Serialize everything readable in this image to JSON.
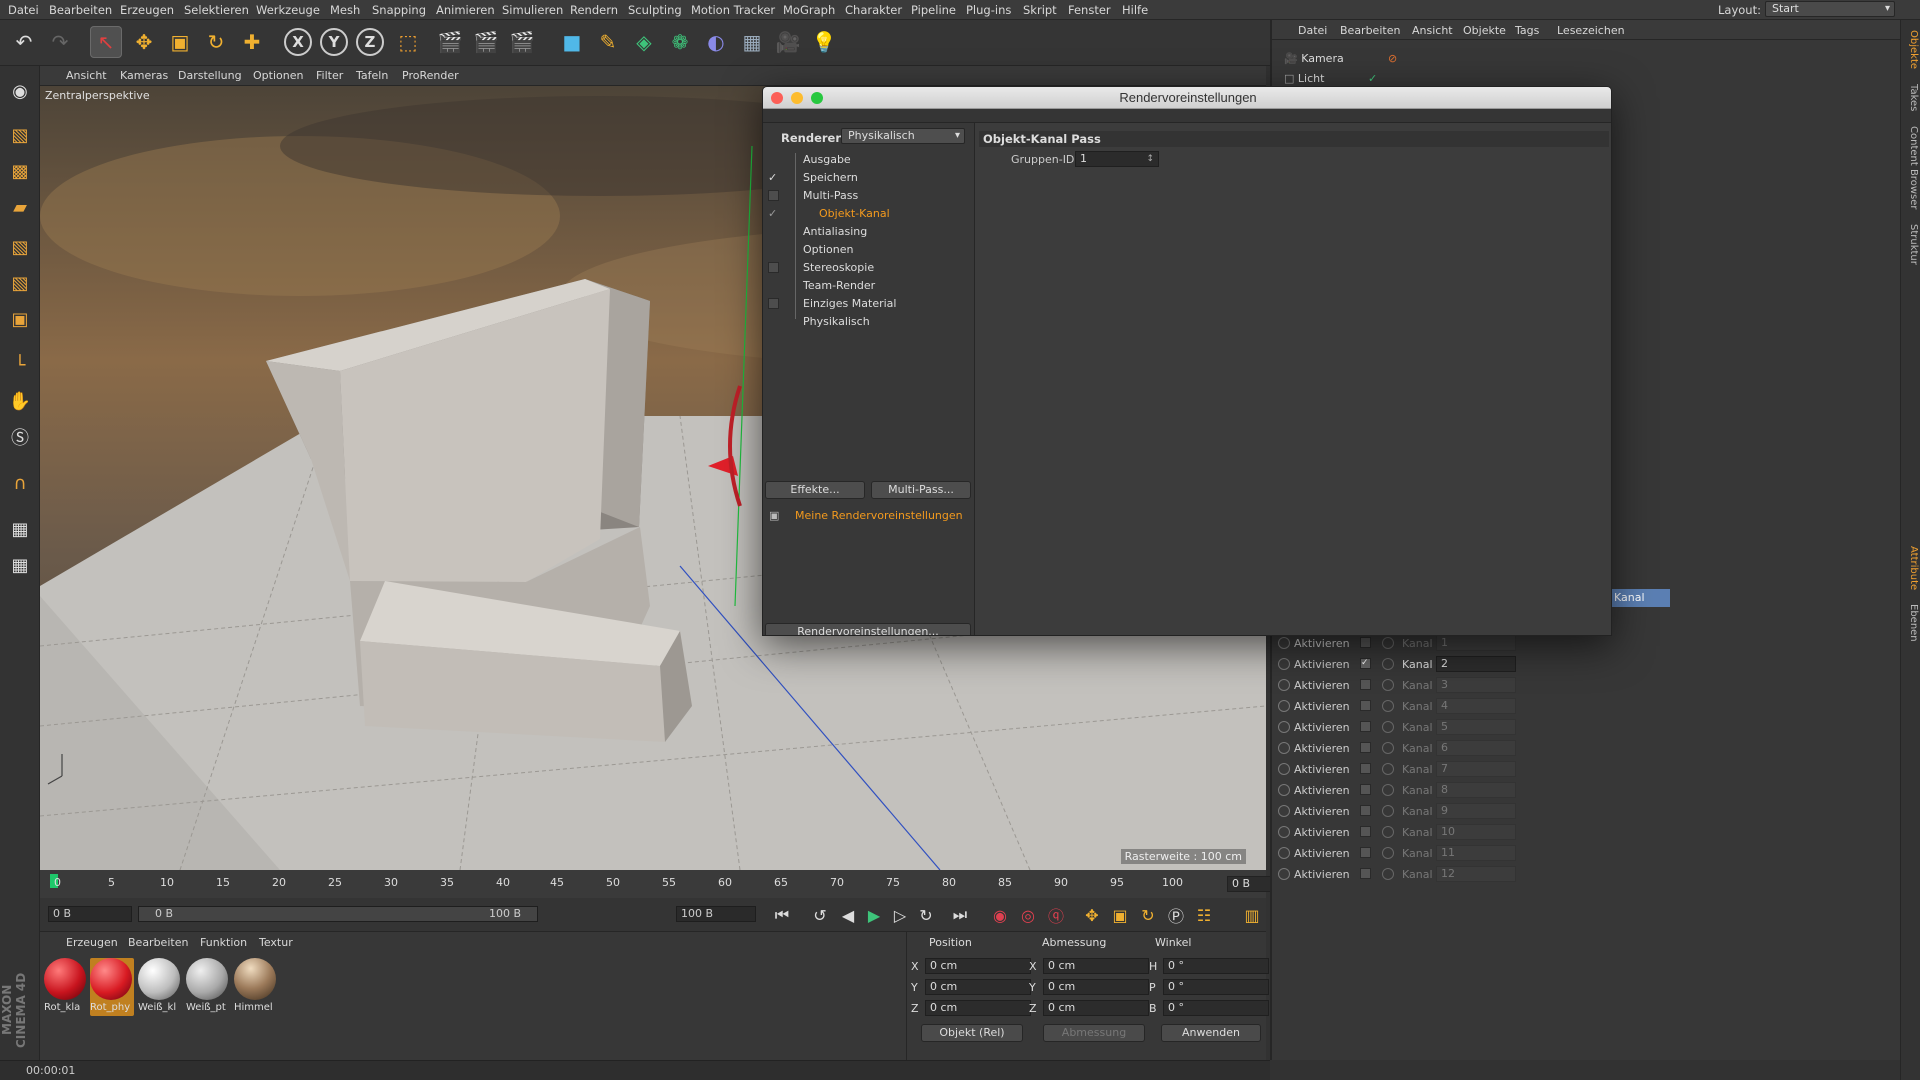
{
  "menubar": {
    "items": [
      "Datei",
      "Bearbeiten",
      "Erzeugen",
      "Selektieren",
      "Werkzeuge",
      "Mesh",
      "Snapping",
      "Animieren",
      "Simulieren",
      "Rendern",
      "Sculpting",
      "Motion Tracker",
      "MoGraph",
      "Charakter",
      "Pipeline",
      "Plug-ins",
      "Skript",
      "Fenster",
      "Hilfe"
    ],
    "layout_label": "Layout:",
    "layout_value": "Start"
  },
  "toolbar": {
    "axis_x": "X",
    "axis_y": "Y",
    "axis_z": "Z"
  },
  "viewport": {
    "menu": [
      "Ansicht",
      "Kameras",
      "Darstellung",
      "Optionen",
      "Filter",
      "Tafeln",
      "ProRender"
    ],
    "label": "Zentralperspektive",
    "raster": "Rasterweite : 100 cm"
  },
  "timeline": {
    "ticks": [
      "0",
      "5",
      "10",
      "15",
      "20",
      "25",
      "30",
      "35",
      "40",
      "45",
      "50",
      "55",
      "60",
      "65",
      "70",
      "75",
      "80",
      "85",
      "90",
      "95",
      "100"
    ],
    "current_frame": "0 B",
    "field_start": "0 B",
    "range_start": "0 B",
    "range_end": "100 B",
    "field_end": "100 B"
  },
  "materials": {
    "menu": [
      "Erzeugen",
      "Bearbeiten",
      "Funktion",
      "Textur"
    ],
    "items": [
      {
        "name": "Rot_kla",
        "color": "#c8141e"
      },
      {
        "name": "Rot_phy",
        "color": "#d81a22"
      },
      {
        "name": "Weiß_kl",
        "color": "#bdbdbd"
      },
      {
        "name": "Weiß_pt",
        "color": "#a9a9a9"
      },
      {
        "name": "Himmel",
        "color": "#9c7a5a"
      }
    ]
  },
  "coords": {
    "headers": [
      "Position",
      "Abmessung",
      "Winkel"
    ],
    "rows": [
      {
        "axis": "X",
        "pos": "0 cm",
        "size_axis": "X",
        "size": "0 cm",
        "rot_axis": "H",
        "rot": "0 °"
      },
      {
        "axis": "Y",
        "pos": "0 cm",
        "size_axis": "Y",
        "size": "0 cm",
        "rot_axis": "P",
        "rot": "0 °"
      },
      {
        "axis": "Z",
        "pos": "0 cm",
        "size_axis": "Z",
        "size": "0 cm",
        "rot_axis": "B",
        "rot": "0 °"
      }
    ],
    "mode": "Objekt (Rel)",
    "size_mode": "Abmessung",
    "apply": "Anwenden"
  },
  "status": {
    "time": "00:00:01"
  },
  "brand": "MAXON CINEMA 4D",
  "object_manager": {
    "menu": [
      "Datei",
      "Bearbeiten",
      "Ansicht",
      "Objekte",
      "Tags",
      "Lesezeichen"
    ],
    "objects": [
      "Kamera",
      "Licht"
    ]
  },
  "attributes": {
    "tab": "Kanal",
    "rows": [
      {
        "activate": "Aktivieren",
        "channel": "Kanal",
        "value": "1",
        "on": false
      },
      {
        "activate": "Aktivieren",
        "channel": "Kanal",
        "value": "2",
        "on": true
      },
      {
        "activate": "Aktivieren",
        "channel": "Kanal",
        "value": "3",
        "on": false
      },
      {
        "activate": "Aktivieren",
        "channel": "Kanal",
        "value": "4",
        "on": false
      },
      {
        "activate": "Aktivieren",
        "channel": "Kanal",
        "value": "5",
        "on": false
      },
      {
        "activate": "Aktivieren",
        "channel": "Kanal",
        "value": "6",
        "on": false
      },
      {
        "activate": "Aktivieren",
        "channel": "Kanal",
        "value": "7",
        "on": false
      },
      {
        "activate": "Aktivieren",
        "channel": "Kanal",
        "value": "8",
        "on": false
      },
      {
        "activate": "Aktivieren",
        "channel": "Kanal",
        "value": "9",
        "on": false
      },
      {
        "activate": "Aktivieren",
        "channel": "Kanal",
        "value": "10",
        "on": false
      },
      {
        "activate": "Aktivieren",
        "channel": "Kanal",
        "value": "11",
        "on": false
      },
      {
        "activate": "Aktivieren",
        "channel": "Kanal",
        "value": "12",
        "on": false
      }
    ]
  },
  "right_tabs": [
    "Objekte",
    "Takes",
    "Content Browser",
    "Struktur",
    "Attribute",
    "Ebenen"
  ],
  "dialog": {
    "title": "Rendervoreinstellungen",
    "renderer_label": "Renderer",
    "renderer_value": "Physikalisch",
    "tree": [
      {
        "label": "Ausgabe",
        "check": ""
      },
      {
        "label": "Speichern",
        "check": "✓"
      },
      {
        "label": "Multi-Pass",
        "check": "box"
      },
      {
        "label": "Objekt-Kanal",
        "check": "✓"
      },
      {
        "label": "Antialiasing",
        "check": ""
      },
      {
        "label": "Optionen",
        "check": ""
      },
      {
        "label": "Stereoskopie",
        "check": "box"
      },
      {
        "label": "Team-Render",
        "check": ""
      },
      {
        "label": "Einziges Material",
        "check": "box"
      },
      {
        "label": "Physikalisch",
        "check": ""
      }
    ],
    "effects_button": "Effekte...",
    "multipass_button": "Multi-Pass...",
    "preset_name": "Meine Rendervoreinstellungen",
    "settings_button": "Rendervoreinstellungen...",
    "pass_header": "Objekt-Kanal Pass",
    "group_id_label": "Gruppen-ID",
    "group_id_value": "1"
  }
}
